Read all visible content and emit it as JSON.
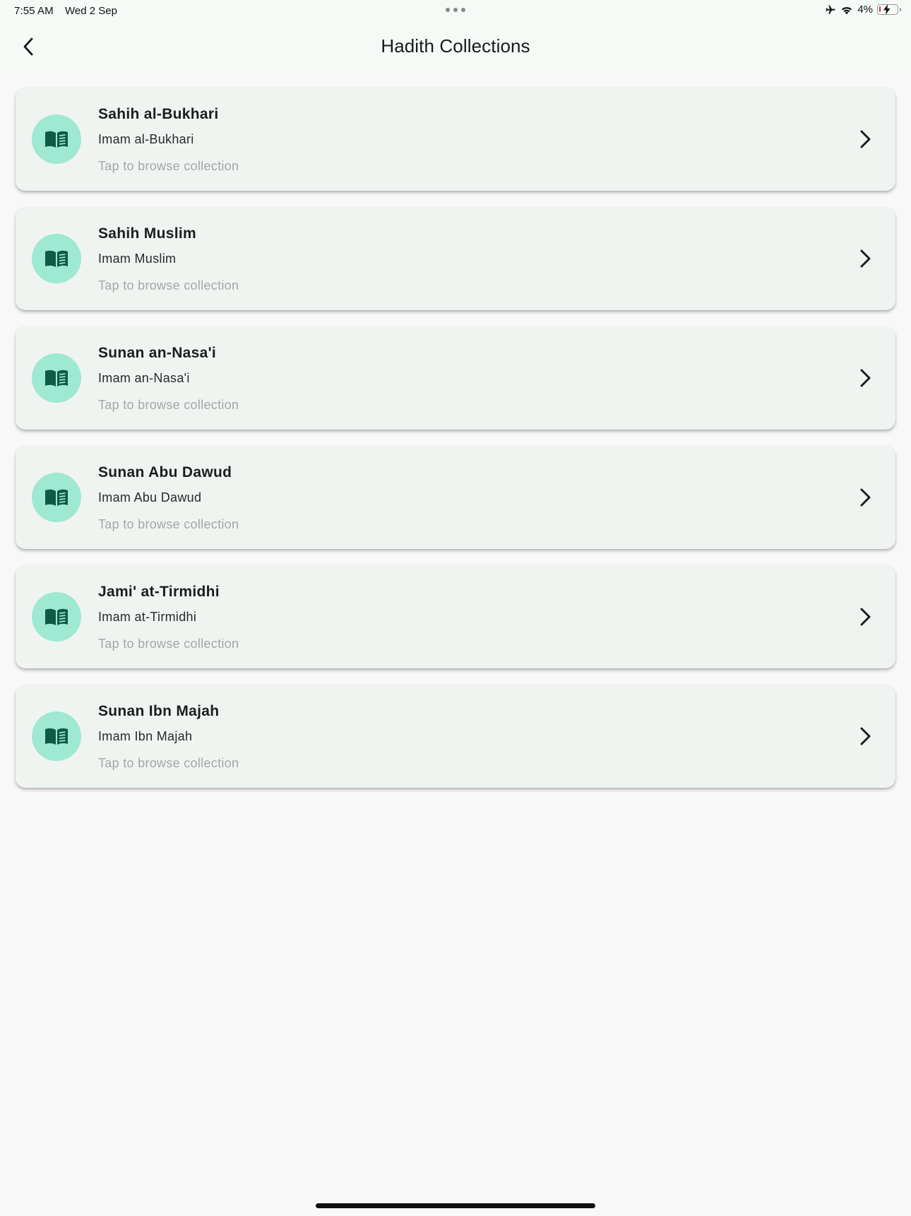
{
  "status_bar": {
    "time": "7:55 AM",
    "date": "Wed 2 Sep",
    "battery_percent_text": "4%",
    "battery_level": 0.04,
    "icons": [
      "airplane-icon",
      "wifi-icon",
      "battery-charging-icon"
    ]
  },
  "header": {
    "title": "Hadith Collections",
    "back_icon": "chevron-left-icon"
  },
  "collections": [
    {
      "title": "Sahih al-Bukhari",
      "author": "Imam al-Bukhari",
      "hint": "Tap to browse collection"
    },
    {
      "title": "Sahih Muslim",
      "author": "Imam Muslim",
      "hint": "Tap to browse collection"
    },
    {
      "title": "Sunan an-Nasa'i",
      "author": "Imam an-Nasa'i",
      "hint": "Tap to browse collection"
    },
    {
      "title": "Sunan Abu Dawud",
      "author": "Imam Abu Dawud",
      "hint": "Tap to browse collection"
    },
    {
      "title": "Jami' at-Tirmidhi",
      "author": "Imam at-Tirmidhi",
      "hint": "Tap to browse collection"
    },
    {
      "title": "Sunan Ibn Majah",
      "author": "Imam Ibn Majah",
      "hint": "Tap to browse collection"
    }
  ],
  "colors": {
    "avatar_bg": "#9fe8d2",
    "icon": "#0f5a45",
    "card_bg": "#eff4f1",
    "header_bg": "#f5faf7",
    "hint_text": "#a3a7a5"
  }
}
